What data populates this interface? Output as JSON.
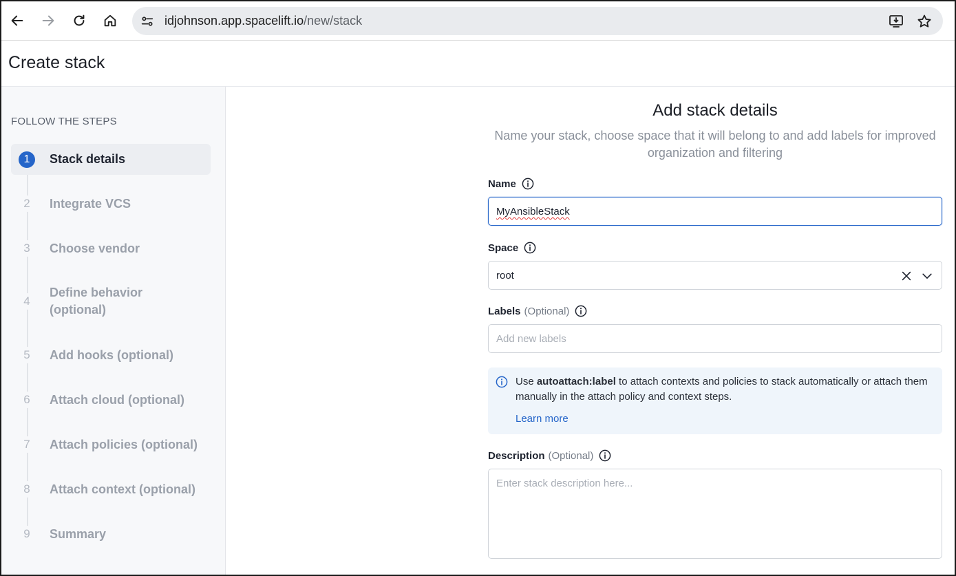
{
  "browser": {
    "url_host": "idjohnson.app.spacelift.io",
    "url_path": "/new/stack"
  },
  "page": {
    "title": "Create stack"
  },
  "sidebar": {
    "heading": "FOLLOW THE STEPS",
    "steps": [
      {
        "number": "1",
        "label": "Stack details",
        "active": true
      },
      {
        "number": "2",
        "label": "Integrate VCS"
      },
      {
        "number": "3",
        "label": "Choose vendor"
      },
      {
        "number": "4",
        "label": "Define behavior (optional)"
      },
      {
        "number": "5",
        "label": "Add hooks (optional)"
      },
      {
        "number": "6",
        "label": "Attach cloud (optional)"
      },
      {
        "number": "7",
        "label": "Attach policies (optional)"
      },
      {
        "number": "8",
        "label": "Attach context (optional)"
      },
      {
        "number": "9",
        "label": "Summary"
      }
    ]
  },
  "main": {
    "title": "Add stack details",
    "subtitle": "Name your stack, choose space that it will belong to and add labels for improved organization and filtering",
    "name": {
      "label": "Name",
      "value": "MyAnsibleStack"
    },
    "space": {
      "label": "Space",
      "value": "root"
    },
    "labels": {
      "label": "Labels",
      "optional": "(Optional)",
      "placeholder": "Add new labels"
    },
    "callout": {
      "prefix": "Use ",
      "keyword": "autoattach:label",
      "suffix": " to attach contexts and policies to stack automatically or attach them manually in the attach policy and context steps.",
      "link": "Learn more"
    },
    "description": {
      "label": "Description",
      "optional": "(Optional)",
      "placeholder": "Enter stack description here..."
    }
  },
  "colors": {
    "accent": "#2565c9",
    "callout_bg": "#eff5fb",
    "sidebar_bg": "#f7f8fa"
  }
}
